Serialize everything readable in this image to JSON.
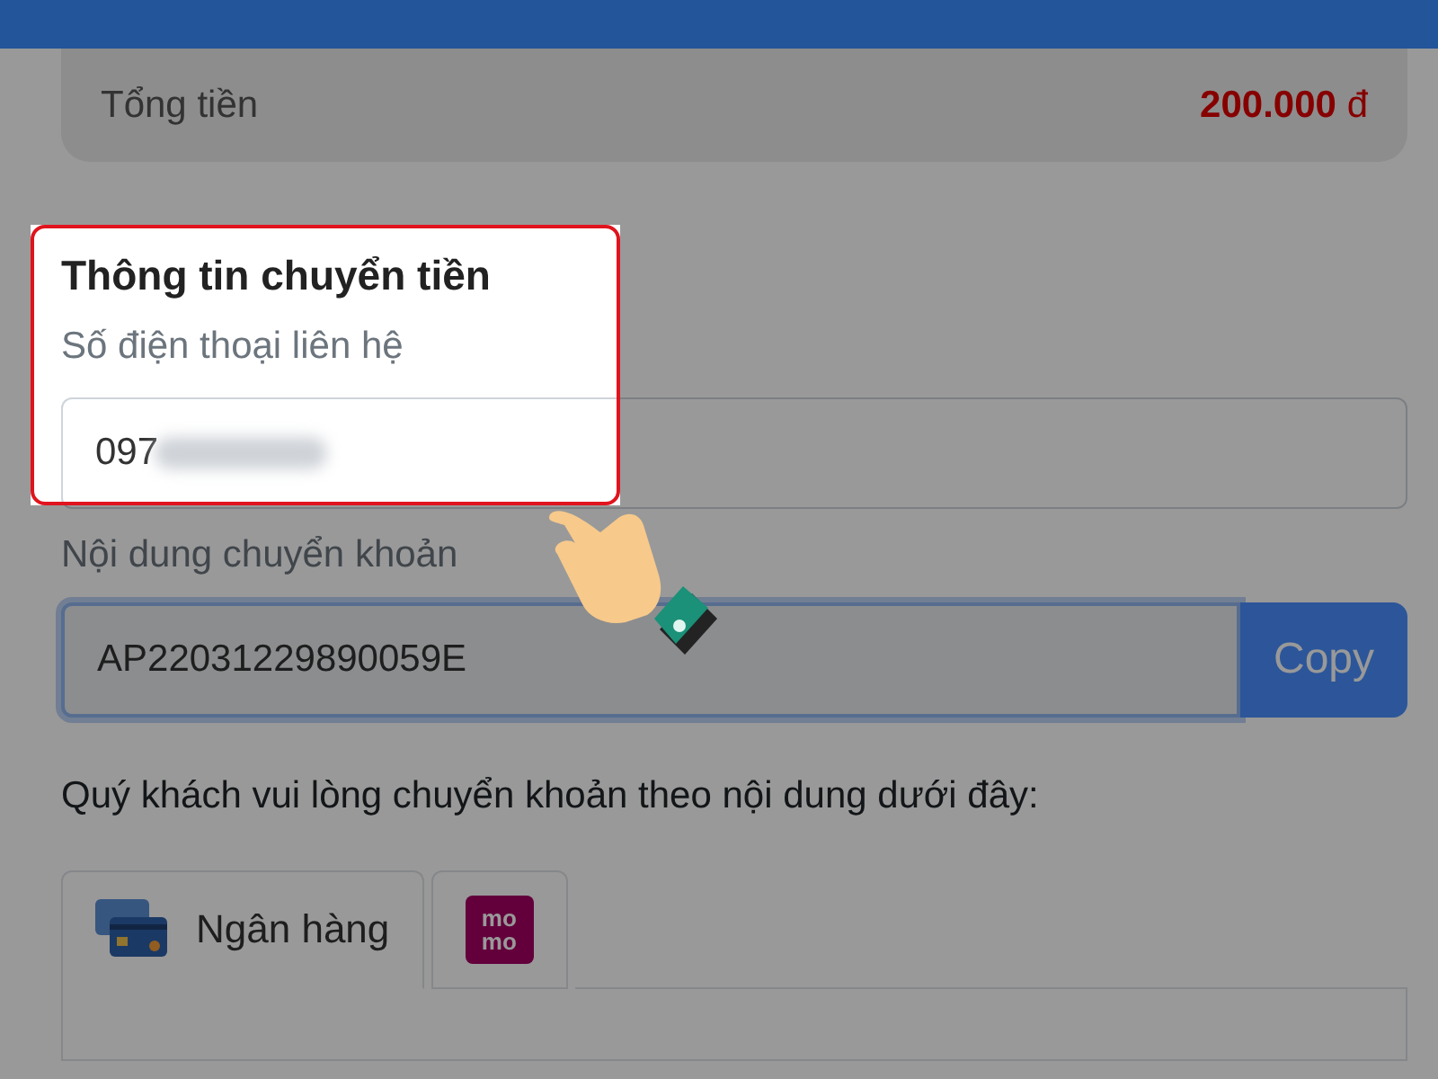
{
  "summary": {
    "label": "Tổng tiền",
    "amount": "200.000",
    "currency": "đ"
  },
  "section": {
    "title": "Thông tin chuyển tiền",
    "highlighted": true
  },
  "phone": {
    "label": "Số điện thoại liên hệ",
    "value": "097",
    "redacted": true
  },
  "transfer": {
    "label": "Nội dung chuyển khoản",
    "value": "AP22031229890059E",
    "button": "Copy"
  },
  "instruction": "Quý khách vui lòng chuyển khoản theo nội dung dưới đây:",
  "tabs": [
    {
      "kind": "bank",
      "label": "Ngân hàng",
      "selected": true
    },
    {
      "kind": "momo",
      "logo_lines": [
        "mo",
        "mo"
      ],
      "selected": false
    }
  ]
}
